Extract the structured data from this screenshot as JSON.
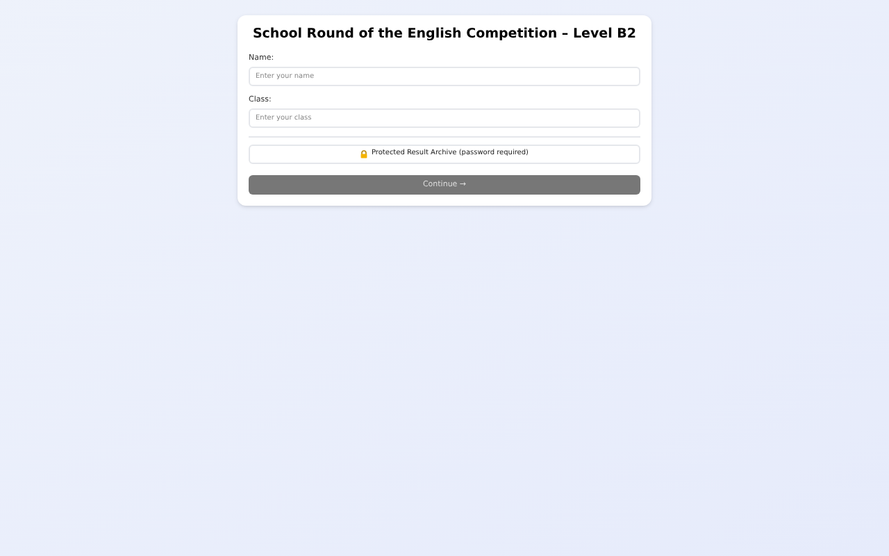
{
  "title": "School Round of the English Competition – Level B2",
  "fields": [
    {
      "label": "Name:",
      "placeholder": "Enter your name"
    },
    {
      "label": "Class:",
      "placeholder": "Enter your class"
    }
  ],
  "archive_button": {
    "label": "Protected Result Archive (password required)"
  },
  "continue_button": {
    "label": "Continue →",
    "disabled": true
  }
}
